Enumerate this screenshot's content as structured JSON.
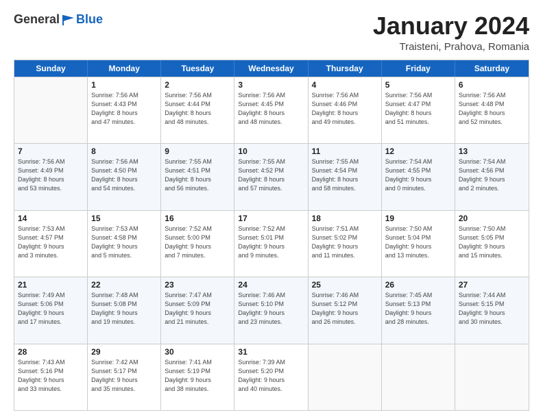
{
  "header": {
    "logo_general": "General",
    "logo_blue": "Blue",
    "title": "January 2024",
    "location": "Traisteni, Prahova, Romania"
  },
  "weekdays": [
    "Sunday",
    "Monday",
    "Tuesday",
    "Wednesday",
    "Thursday",
    "Friday",
    "Saturday"
  ],
  "rows": [
    [
      {
        "date": "",
        "info": ""
      },
      {
        "date": "1",
        "info": "Sunrise: 7:56 AM\nSunset: 4:43 PM\nDaylight: 8 hours\nand 47 minutes."
      },
      {
        "date": "2",
        "info": "Sunrise: 7:56 AM\nSunset: 4:44 PM\nDaylight: 8 hours\nand 48 minutes."
      },
      {
        "date": "3",
        "info": "Sunrise: 7:56 AM\nSunset: 4:45 PM\nDaylight: 8 hours\nand 48 minutes."
      },
      {
        "date": "4",
        "info": "Sunrise: 7:56 AM\nSunset: 4:46 PM\nDaylight: 8 hours\nand 49 minutes."
      },
      {
        "date": "5",
        "info": "Sunrise: 7:56 AM\nSunset: 4:47 PM\nDaylight: 8 hours\nand 51 minutes."
      },
      {
        "date": "6",
        "info": "Sunrise: 7:56 AM\nSunset: 4:48 PM\nDaylight: 8 hours\nand 52 minutes."
      }
    ],
    [
      {
        "date": "7",
        "info": "Sunrise: 7:56 AM\nSunset: 4:49 PM\nDaylight: 8 hours\nand 53 minutes."
      },
      {
        "date": "8",
        "info": "Sunrise: 7:56 AM\nSunset: 4:50 PM\nDaylight: 8 hours\nand 54 minutes."
      },
      {
        "date": "9",
        "info": "Sunrise: 7:55 AM\nSunset: 4:51 PM\nDaylight: 8 hours\nand 56 minutes."
      },
      {
        "date": "10",
        "info": "Sunrise: 7:55 AM\nSunset: 4:52 PM\nDaylight: 8 hours\nand 57 minutes."
      },
      {
        "date": "11",
        "info": "Sunrise: 7:55 AM\nSunset: 4:54 PM\nDaylight: 8 hours\nand 58 minutes."
      },
      {
        "date": "12",
        "info": "Sunrise: 7:54 AM\nSunset: 4:55 PM\nDaylight: 9 hours\nand 0 minutes."
      },
      {
        "date": "13",
        "info": "Sunrise: 7:54 AM\nSunset: 4:56 PM\nDaylight: 9 hours\nand 2 minutes."
      }
    ],
    [
      {
        "date": "14",
        "info": "Sunrise: 7:53 AM\nSunset: 4:57 PM\nDaylight: 9 hours\nand 3 minutes."
      },
      {
        "date": "15",
        "info": "Sunrise: 7:53 AM\nSunset: 4:58 PM\nDaylight: 9 hours\nand 5 minutes."
      },
      {
        "date": "16",
        "info": "Sunrise: 7:52 AM\nSunset: 5:00 PM\nDaylight: 9 hours\nand 7 minutes."
      },
      {
        "date": "17",
        "info": "Sunrise: 7:52 AM\nSunset: 5:01 PM\nDaylight: 9 hours\nand 9 minutes."
      },
      {
        "date": "18",
        "info": "Sunrise: 7:51 AM\nSunset: 5:02 PM\nDaylight: 9 hours\nand 11 minutes."
      },
      {
        "date": "19",
        "info": "Sunrise: 7:50 AM\nSunset: 5:04 PM\nDaylight: 9 hours\nand 13 minutes."
      },
      {
        "date": "20",
        "info": "Sunrise: 7:50 AM\nSunset: 5:05 PM\nDaylight: 9 hours\nand 15 minutes."
      }
    ],
    [
      {
        "date": "21",
        "info": "Sunrise: 7:49 AM\nSunset: 5:06 PM\nDaylight: 9 hours\nand 17 minutes."
      },
      {
        "date": "22",
        "info": "Sunrise: 7:48 AM\nSunset: 5:08 PM\nDaylight: 9 hours\nand 19 minutes."
      },
      {
        "date": "23",
        "info": "Sunrise: 7:47 AM\nSunset: 5:09 PM\nDaylight: 9 hours\nand 21 minutes."
      },
      {
        "date": "24",
        "info": "Sunrise: 7:46 AM\nSunset: 5:10 PM\nDaylight: 9 hours\nand 23 minutes."
      },
      {
        "date": "25",
        "info": "Sunrise: 7:46 AM\nSunset: 5:12 PM\nDaylight: 9 hours\nand 26 minutes."
      },
      {
        "date": "26",
        "info": "Sunrise: 7:45 AM\nSunset: 5:13 PM\nDaylight: 9 hours\nand 28 minutes."
      },
      {
        "date": "27",
        "info": "Sunrise: 7:44 AM\nSunset: 5:15 PM\nDaylight: 9 hours\nand 30 minutes."
      }
    ],
    [
      {
        "date": "28",
        "info": "Sunrise: 7:43 AM\nSunset: 5:16 PM\nDaylight: 9 hours\nand 33 minutes."
      },
      {
        "date": "29",
        "info": "Sunrise: 7:42 AM\nSunset: 5:17 PM\nDaylight: 9 hours\nand 35 minutes."
      },
      {
        "date": "30",
        "info": "Sunrise: 7:41 AM\nSunset: 5:19 PM\nDaylight: 9 hours\nand 38 minutes."
      },
      {
        "date": "31",
        "info": "Sunrise: 7:39 AM\nSunset: 5:20 PM\nDaylight: 9 hours\nand 40 minutes."
      },
      {
        "date": "",
        "info": ""
      },
      {
        "date": "",
        "info": ""
      },
      {
        "date": "",
        "info": ""
      }
    ]
  ]
}
